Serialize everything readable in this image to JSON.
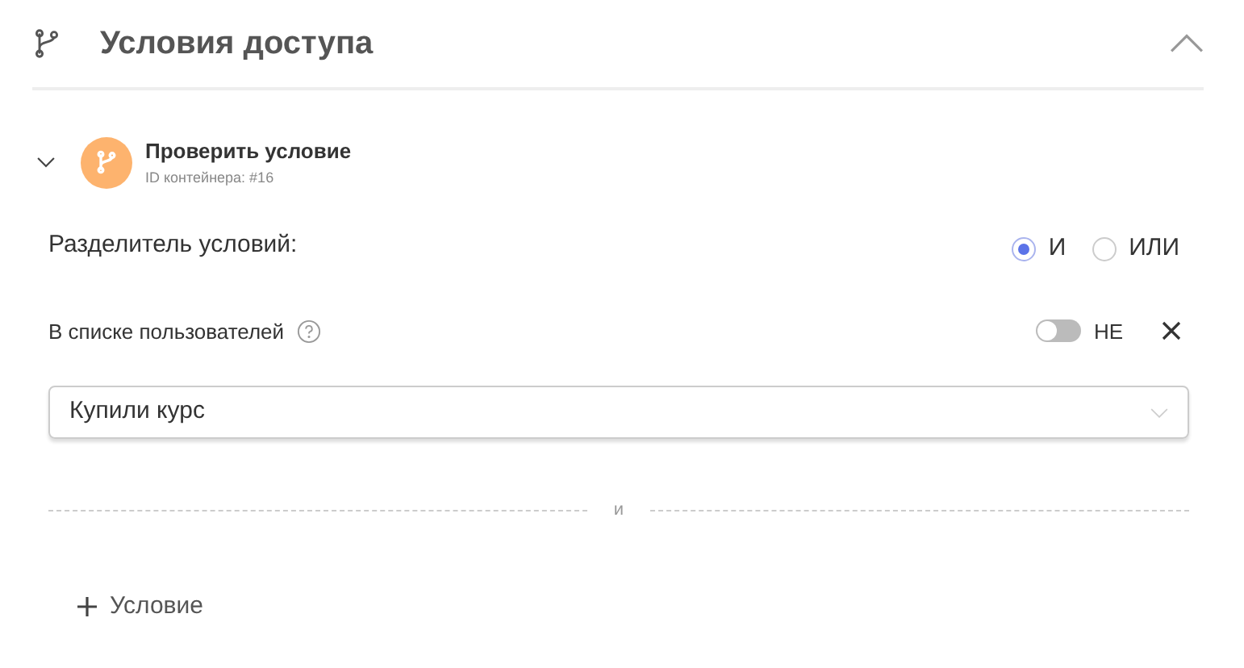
{
  "section": {
    "title": "Условия доступа",
    "expanded": true
  },
  "block": {
    "title": "Проверить условие",
    "subtitle": "ID контейнера: #16",
    "expanded": true
  },
  "separator": {
    "label": "Разделитель условий:",
    "options": [
      {
        "label": "И",
        "selected": true
      },
      {
        "label": "ИЛИ",
        "selected": false
      }
    ]
  },
  "condition": {
    "label": "В списке пользователей",
    "negate": {
      "label": "НЕ",
      "on": false
    },
    "value": "Купили курс"
  },
  "divider_label": "и",
  "add_button": "Условие"
}
